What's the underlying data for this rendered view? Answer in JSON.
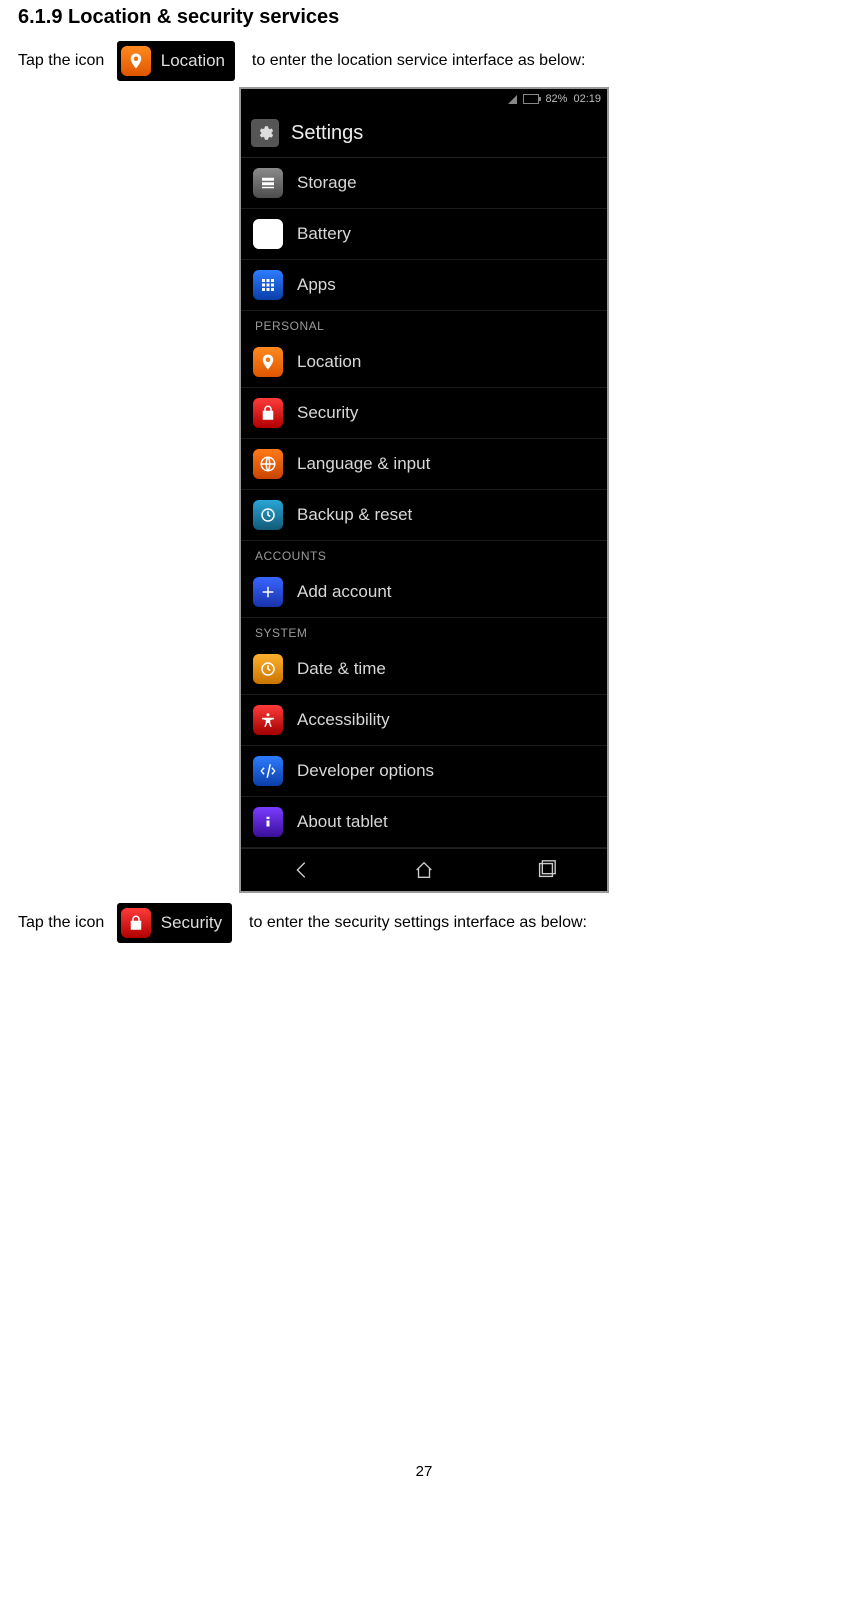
{
  "doc": {
    "section_title": "6.1.9 Location & security services",
    "line1_pre": "Tap the icon ",
    "line1_post": "  to enter the location service interface as below:",
    "line2_pre": "Tap the icon ",
    "line2_post": "  to enter the security settings interface as below:",
    "page_number": "27"
  },
  "chip_location": {
    "label": "Location"
  },
  "chip_security": {
    "label": "Security"
  },
  "phone": {
    "status": {
      "battery_pct": "82%",
      "time": "02:19"
    },
    "header": "Settings",
    "cats": {
      "personal": "PERSONAL",
      "accounts": "ACCOUNTS",
      "system": "SYSTEM"
    },
    "items": {
      "storage": "Storage",
      "battery": "Battery",
      "apps": "Apps",
      "location": "Location",
      "security": "Security",
      "language": "Language & input",
      "backup": "Backup & reset",
      "addaccount": "Add account",
      "datetime": "Date & time",
      "accessibility": "Accessibility",
      "developer": "Developer options",
      "about": "About tablet"
    }
  }
}
